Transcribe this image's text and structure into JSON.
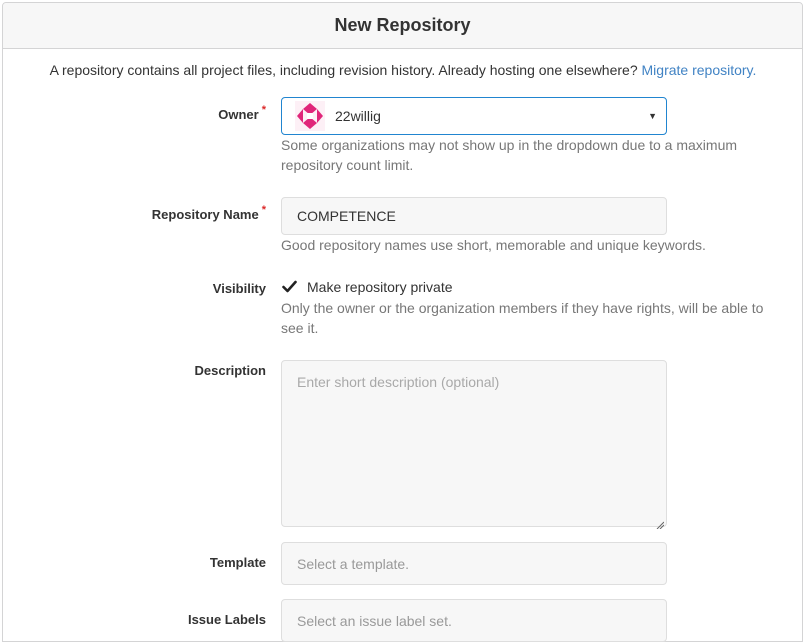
{
  "header": {
    "title": "New Repository"
  },
  "intro": {
    "text": "A repository contains all project files, including revision history. Already hosting one elsewhere?",
    "link": "Migrate repository."
  },
  "owner": {
    "label": "Owner",
    "required_mark": "*",
    "value": "22willig",
    "help": "Some organizations may not show up in the dropdown due to a maximum repository count limit."
  },
  "repo_name": {
    "label": "Repository Name",
    "required_mark": "*",
    "value": "COMPETENCE",
    "help": "Good repository names use short, memorable and unique keywords."
  },
  "visibility": {
    "label": "Visibility",
    "checkbox_label": "Make repository private",
    "checked": true,
    "help": "Only the owner or the organization members if they have rights, will be able to see it."
  },
  "description": {
    "label": "Description",
    "placeholder": "Enter short description (optional)"
  },
  "template": {
    "label": "Template",
    "placeholder": "Select a template."
  },
  "issue_labels": {
    "label": "Issue Labels",
    "placeholder": "Select an issue label set."
  },
  "colors": {
    "accent": "#2185d0",
    "link": "#4183c4",
    "required": "#db2828",
    "avatar": "#e0267a"
  }
}
